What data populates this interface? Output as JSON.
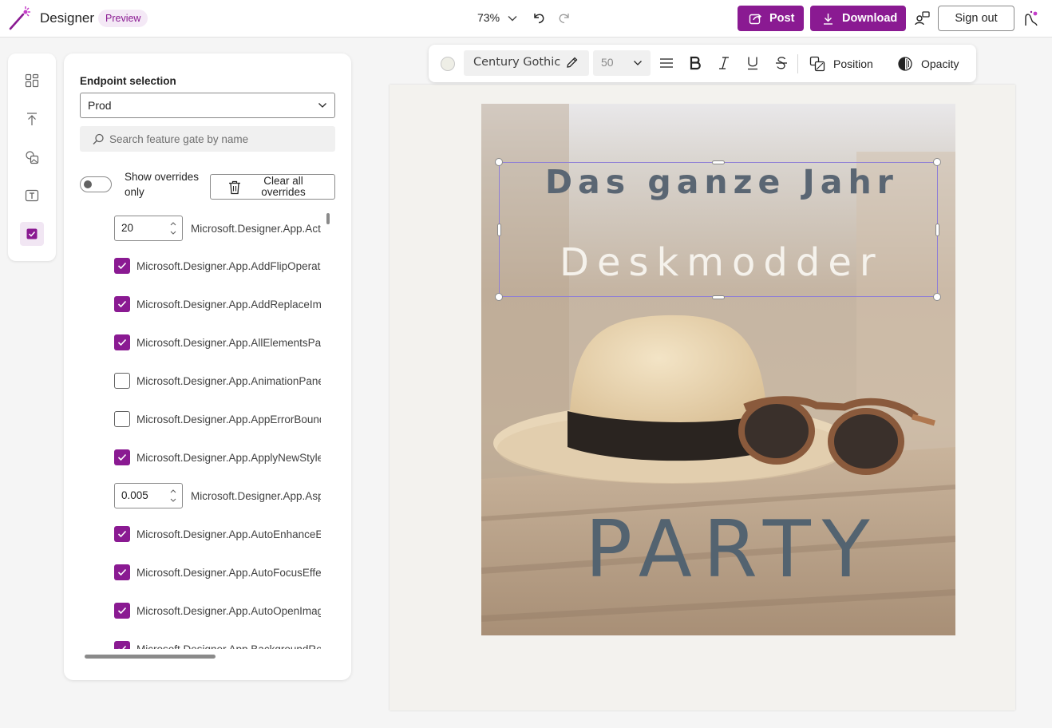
{
  "header": {
    "app_title": "Designer",
    "badge": "Preview",
    "zoom": "73%",
    "post_label": "Post",
    "download_label": "Download",
    "signout_label": "Sign out"
  },
  "colors": {
    "accent": "#8a1a92",
    "badge_bg": "#f4e9f6",
    "selection": "#8f7fd6"
  },
  "rail": {
    "items": [
      "templates-icon",
      "upload-icon",
      "media-icon",
      "text-icon",
      "feature-flags-icon"
    ],
    "active": "feature-flags-icon"
  },
  "panel": {
    "endpoint_label": "Endpoint selection",
    "endpoint_value": "Prod",
    "search_placeholder": "Search feature gate by name",
    "toggle_label": "Show overrides only",
    "toggle_on": false,
    "clear_label": "Clear all overrides",
    "gates": [
      {
        "type": "number",
        "value": "20",
        "name": "Microsoft.Designer.App.Act"
      },
      {
        "type": "check",
        "checked": true,
        "name": "Microsoft.Designer.App.AddFlipOperat"
      },
      {
        "type": "check",
        "checked": true,
        "name": "Microsoft.Designer.App.AddReplaceIma"
      },
      {
        "type": "check",
        "checked": true,
        "name": "Microsoft.Designer.App.AllElementsPar"
      },
      {
        "type": "check",
        "checked": false,
        "name": "Microsoft.Designer.App.AnimationPane"
      },
      {
        "type": "check",
        "checked": false,
        "name": "Microsoft.Designer.App.AppErrorBound"
      },
      {
        "type": "check",
        "checked": true,
        "name": "Microsoft.Designer.App.ApplyNewStyle"
      },
      {
        "type": "number",
        "value": "0.005",
        "name": "Microsoft.Designer.App.Asp"
      },
      {
        "type": "check",
        "checked": true,
        "name": "Microsoft.Designer.App.AutoEnhanceEf"
      },
      {
        "type": "check",
        "checked": true,
        "name": "Microsoft.Designer.App.AutoFocusEffe"
      },
      {
        "type": "check",
        "checked": true,
        "name": "Microsoft.Designer.App.AutoOpenImag"
      },
      {
        "type": "check",
        "checked": true,
        "name": "Microsoft.Designer.App.BackgroundRe"
      }
    ]
  },
  "toolbar": {
    "font_name": "Century Gothic",
    "font_size": "50",
    "position_label": "Position",
    "opacity_label": "Opacity",
    "swatch_color": "#eeeee6"
  },
  "design": {
    "heading": "Das ganze Jahr",
    "brand": "Deskmodder",
    "party": "PARTY"
  }
}
